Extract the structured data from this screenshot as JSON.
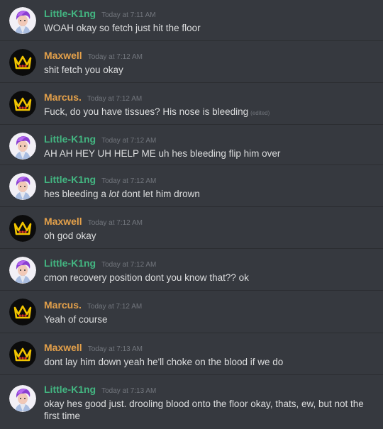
{
  "colors": {
    "little_k1ng": "#43b581",
    "maxwell": "#e3a04a",
    "marcus": "#e3a04a",
    "background": "#36393f"
  },
  "messages": [
    {
      "user": "Little-K1ng",
      "time": "Today at 7:11 AM",
      "text": "WOAH okay so fetch just hit the floor",
      "avatar": "purple-hair-avatar"
    },
    {
      "user": "Maxwell",
      "time": "Today at 7:12 AM",
      "text": "shit fetch you okay",
      "avatar": "crown-avatar"
    },
    {
      "user": "Marcus.",
      "time": "Today at 7:12 AM",
      "text": "Fuck, do you have tissues? His nose is bleeding",
      "edited": "(edited)",
      "avatar": "crown-avatar"
    },
    {
      "user": "Little-K1ng",
      "time": "Today at 7:12 AM",
      "text": "AH AH HEY UH HELP ME uh hes bleeding flip him over",
      "avatar": "purple-hair-avatar"
    },
    {
      "user": "Little-K1ng",
      "time": "Today at 7:12 AM",
      "text_pre": "hes bleeding a ",
      "text_em": "lot",
      "text_post": " dont let him drown",
      "avatar": "purple-hair-avatar"
    },
    {
      "user": "Maxwell",
      "time": "Today at 7:12 AM",
      "text": "oh god okay",
      "avatar": "crown-avatar"
    },
    {
      "user": "Little-K1ng",
      "time": "Today at 7:12 AM",
      "text": "cmon recovery position dont you know that?? ok",
      "avatar": "purple-hair-avatar"
    },
    {
      "user": "Marcus.",
      "time": "Today at 7:12 AM",
      "text": "Yeah of course",
      "avatar": "crown-avatar"
    },
    {
      "user": "Maxwell",
      "time": "Today at 7:13 AM",
      "text": "dont lay him down yeah he'll choke on  the blood if we do",
      "avatar": "crown-avatar"
    },
    {
      "user": "Little-K1ng",
      "time": "Today at 7:13 AM",
      "text": "okay hes good just. drooling blood onto the floor okay, thats, ew, but not the first time",
      "avatar": "purple-hair-avatar"
    }
  ]
}
